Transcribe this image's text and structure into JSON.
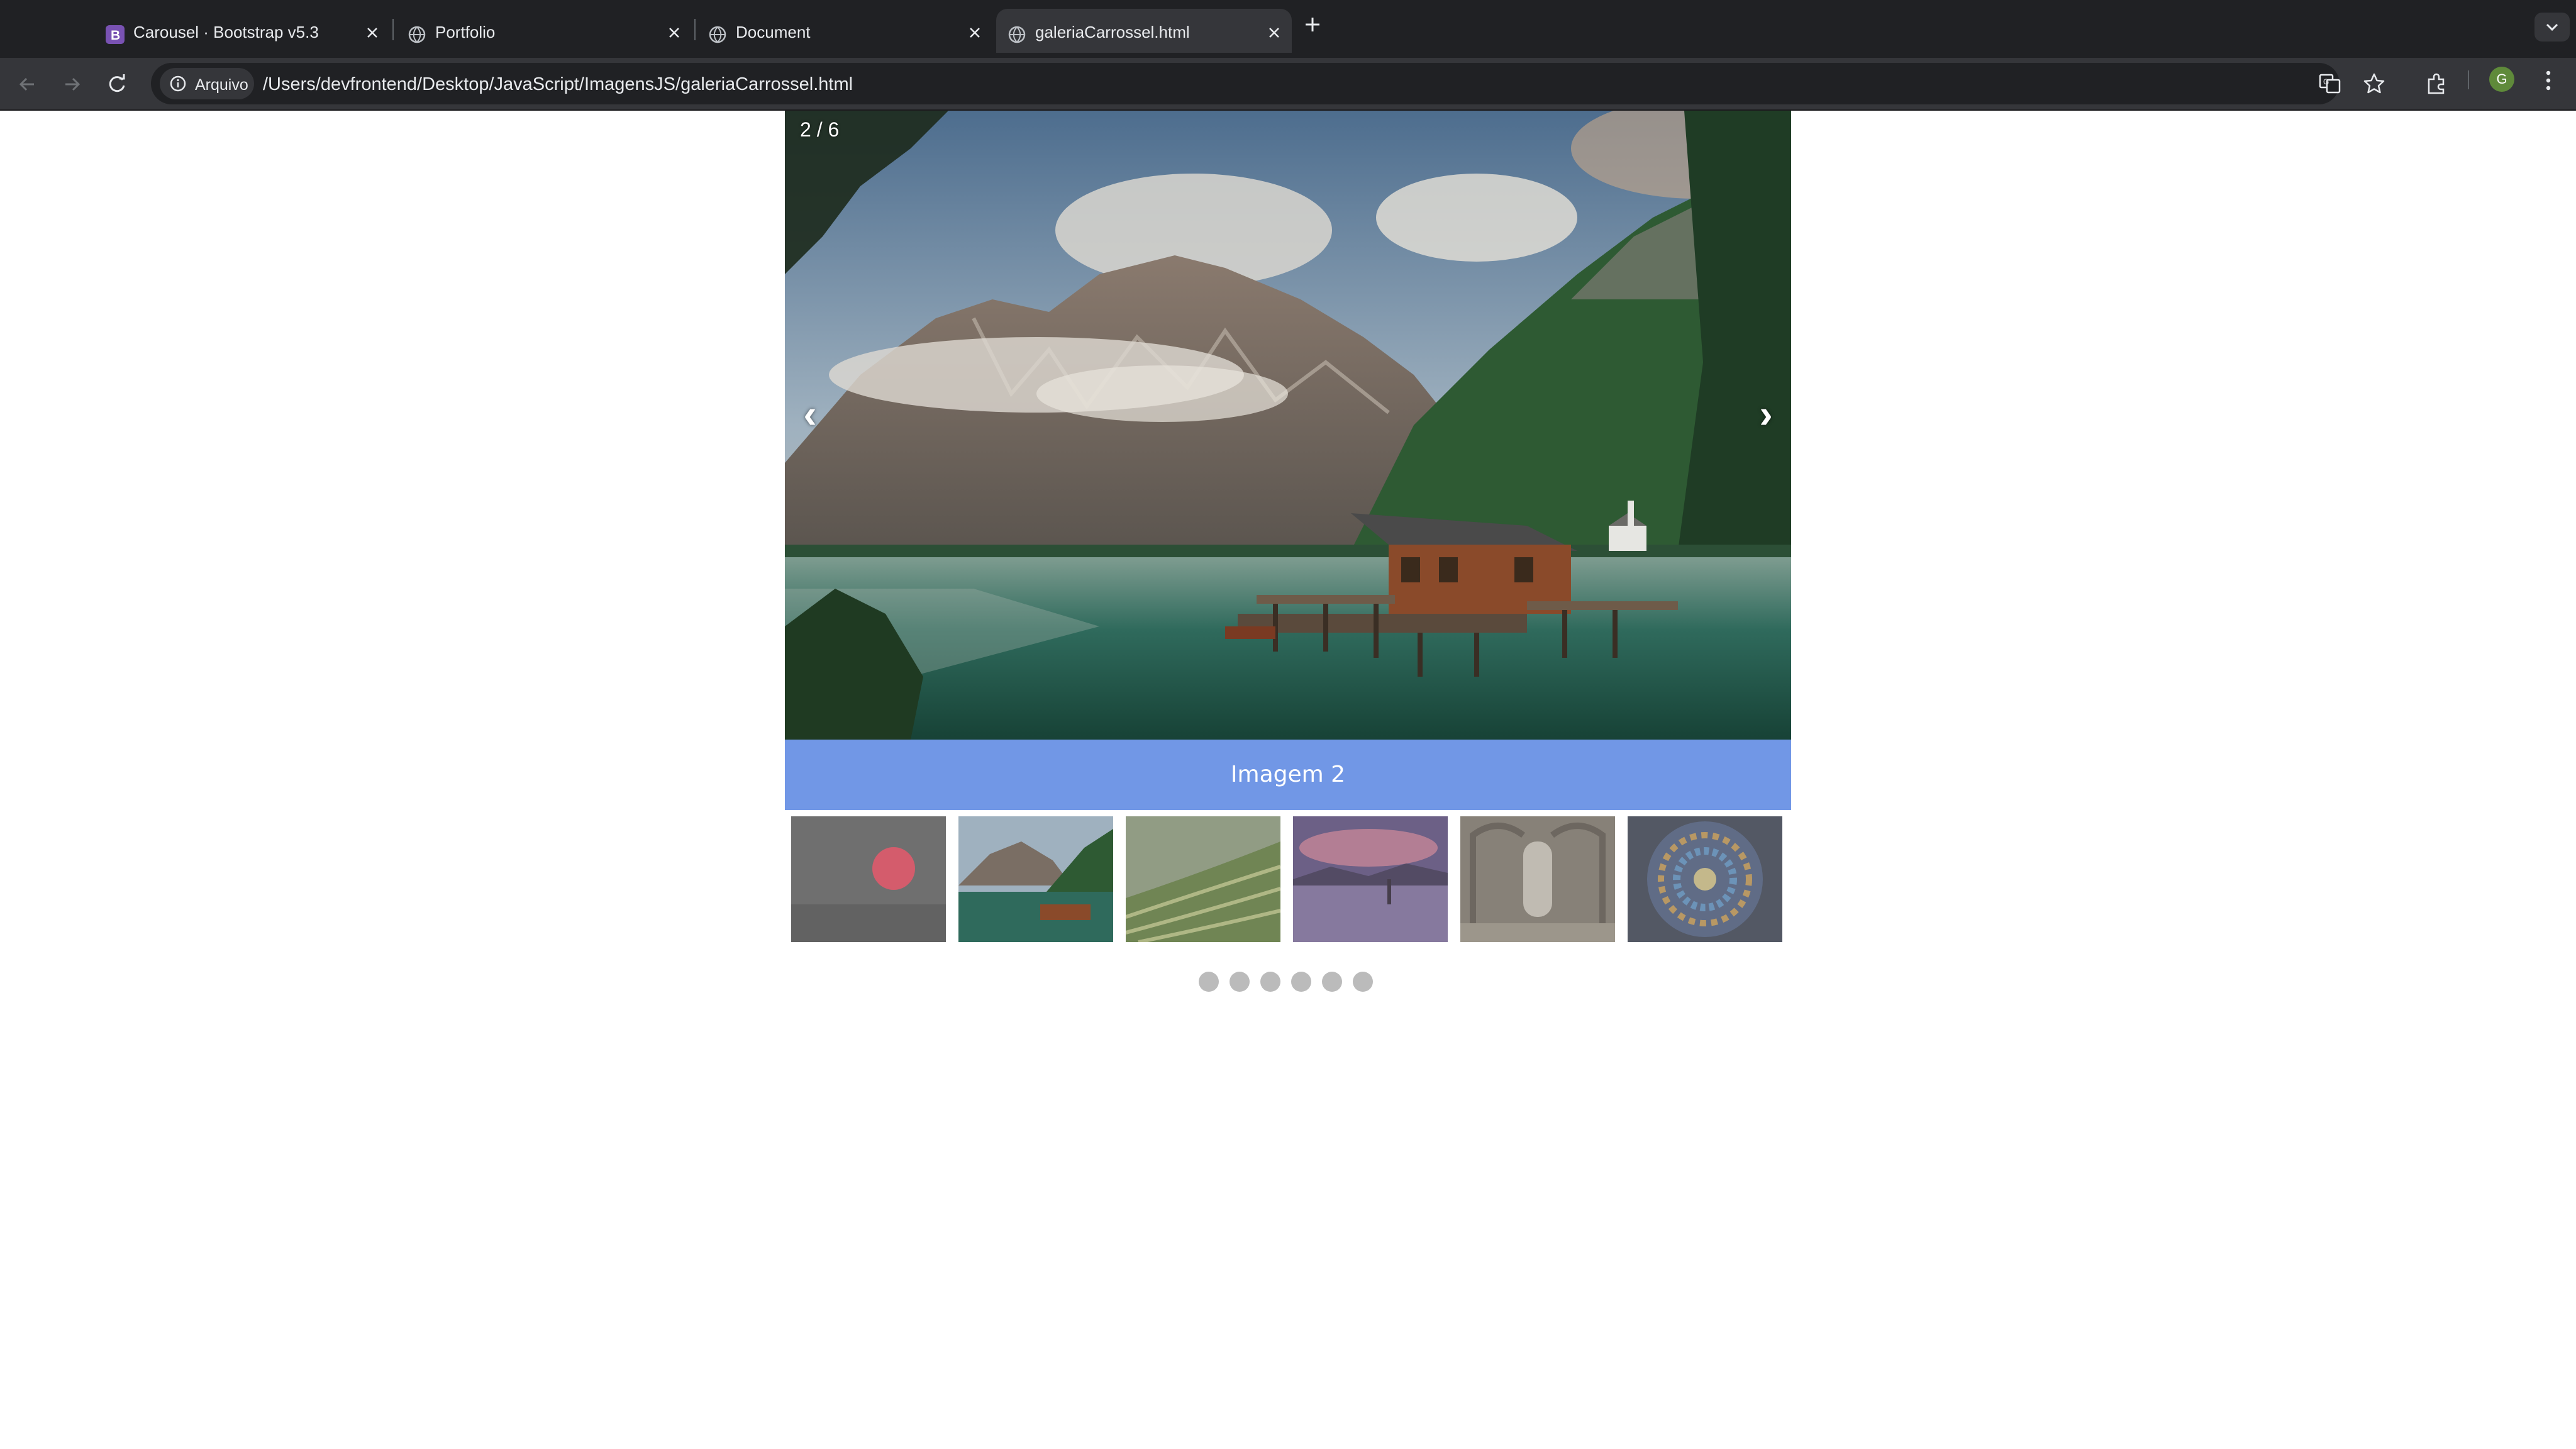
{
  "browser": {
    "tabs": [
      {
        "title": "Carousel · Bootstrap v5.3",
        "favicon": "bootstrap-icon"
      },
      {
        "title": "Portfolio",
        "favicon": "globe-icon"
      },
      {
        "title": "Document",
        "favicon": "globe-icon"
      },
      {
        "title": "galeriaCarrossel.html",
        "favicon": "globe-icon",
        "active": true
      }
    ],
    "address_chip": "Arquivo",
    "url": "/Users/devfrontend/Desktop/JavaScript/ImagensJS/galeriaCarrossel.html",
    "avatar_letter": "G"
  },
  "carousel": {
    "counter": "2 / 6",
    "prev_label": "‹",
    "next_label": "›",
    "caption": "Imagem 2",
    "caption_color": "#7197e6",
    "current_index": 2,
    "total": 6,
    "thumbnails": [
      {
        "name": "thumbnail-red-sun"
      },
      {
        "name": "thumbnail-mountain-lake"
      },
      {
        "name": "thumbnail-rice-terraces"
      },
      {
        "name": "thumbnail-sunset-lake"
      },
      {
        "name": "thumbnail-cloister"
      },
      {
        "name": "thumbnail-stained-glass"
      }
    ]
  }
}
